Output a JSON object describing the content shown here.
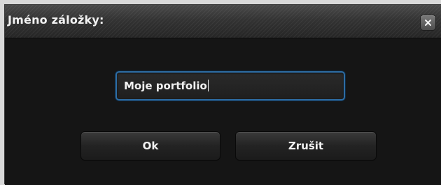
{
  "dialog": {
    "title": "Jméno záložky:",
    "close_icon": "close-icon",
    "input": {
      "value": "Moje portfolio",
      "focus_color": "#2e6da4"
    },
    "buttons": {
      "ok_label": "Ok",
      "cancel_label": "Zrušit"
    }
  }
}
